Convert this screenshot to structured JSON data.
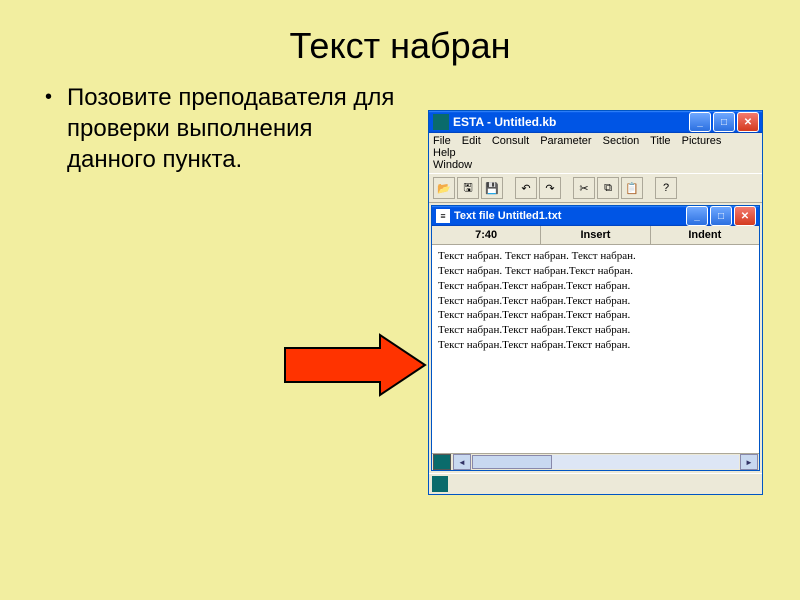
{
  "slide": {
    "title": "Текст набран",
    "bullet": "Позовите преподавателя для проверки выполнения данного пункта."
  },
  "app": {
    "title": "ESTA - Untitled.kb",
    "menu": {
      "file": "File",
      "edit": "Edit",
      "consult": "Consult",
      "parameter": "Parameter",
      "section": "Section",
      "title": "Title",
      "pictures": "Pictures",
      "help": "Help",
      "window": "Window"
    },
    "inner": {
      "title": "Text file Untitled1.txt",
      "status": {
        "pos": "7:40",
        "insert": "Insert",
        "indent": "Indent"
      },
      "lines": [
        "Текст набран. Текст набран. Текст набран.",
        "Текст набран. Текст набран.Текст набран.",
        "Текст набран.Текст набран.Текст набран.",
        "Текст набран.Текст набран.Текст набран.",
        "Текст набран.Текст набран.Текст набран.",
        "Текст набран.Текст набран.Текст набран.",
        "Текст набран.Текст набран.Текст набран."
      ]
    }
  }
}
